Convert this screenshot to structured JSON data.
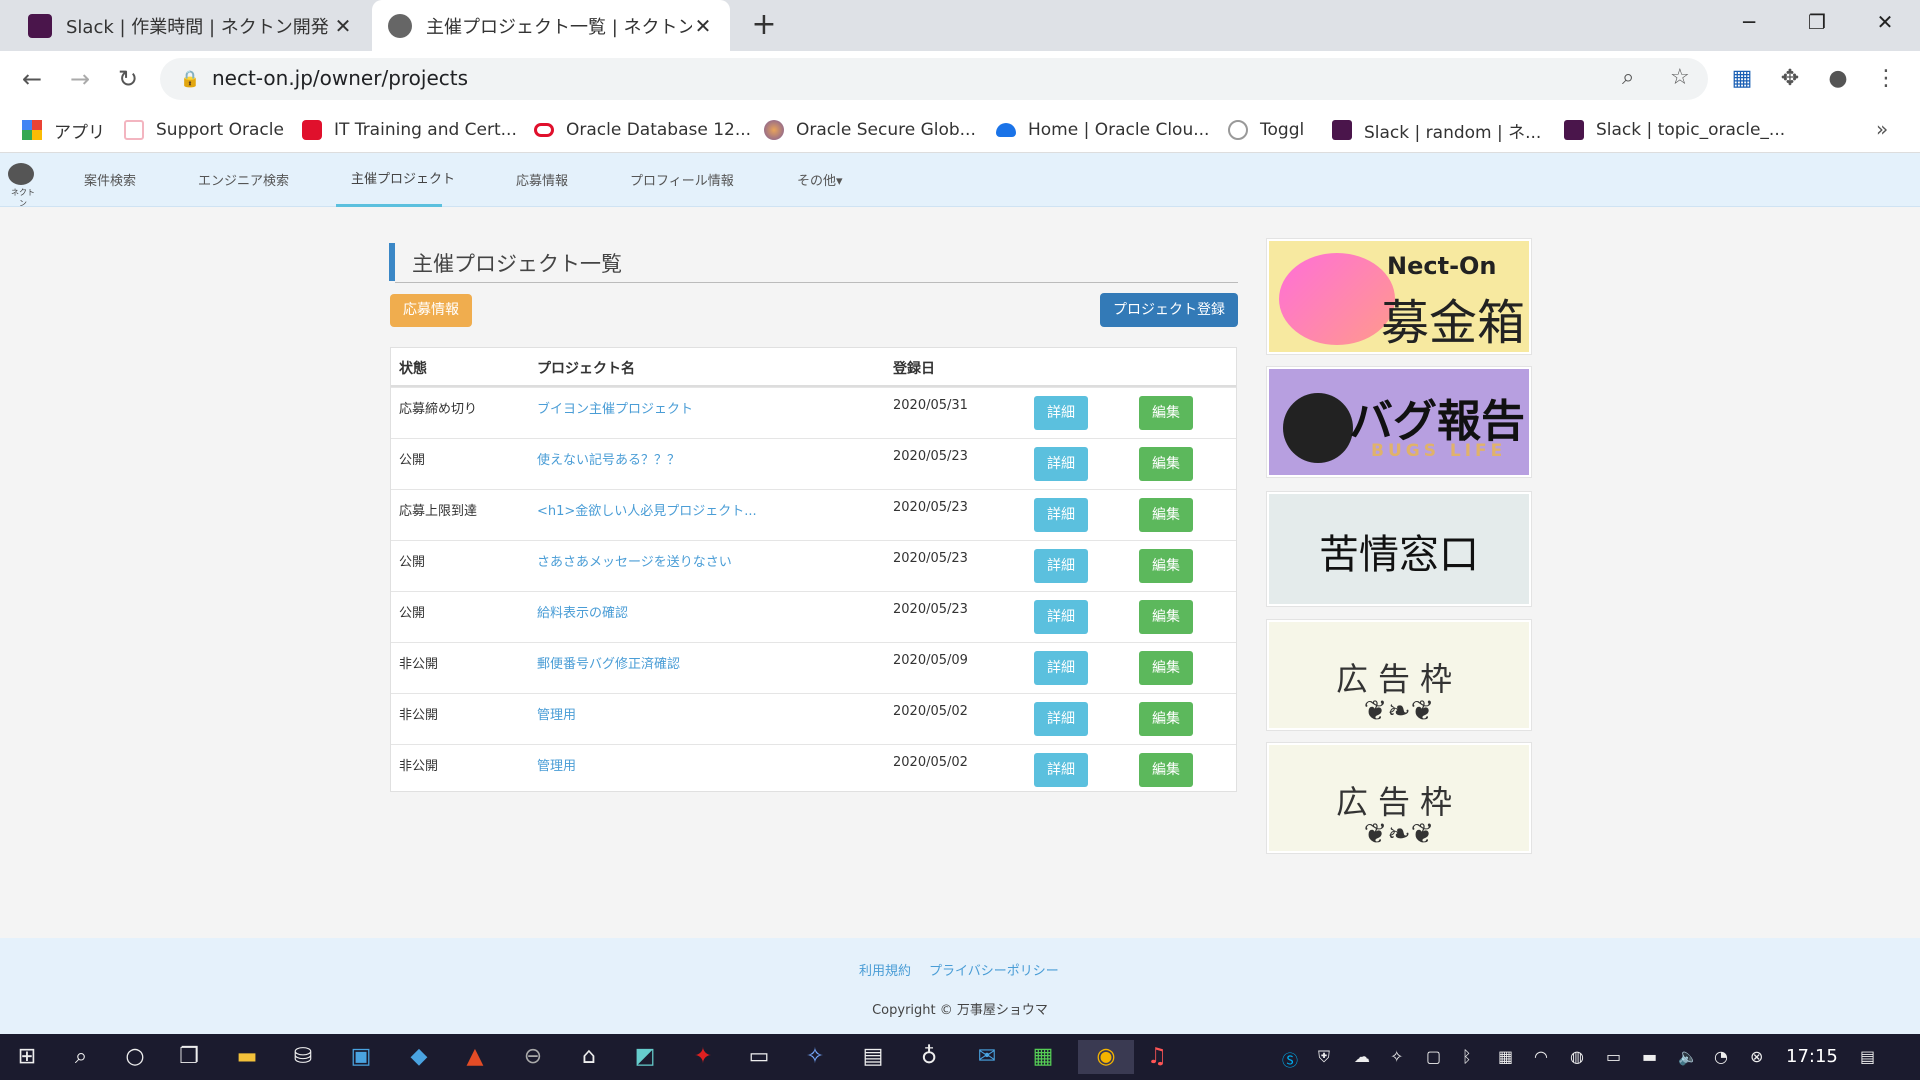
{
  "browser": {
    "tabs": [
      {
        "title": "Slack | 作業時間 | ネクトン開発",
        "close": "✕",
        "favicon": "slack-icon"
      },
      {
        "title": "主催プロジェクト一覧 | ネクトン",
        "close": "✕",
        "favicon": "nectone-icon"
      }
    ],
    "new_tab": "+",
    "window_controls": {
      "minimize": "─",
      "maximize": "❐",
      "close": "✕"
    },
    "url": "nect-on.jp/owner/projects",
    "bookmarks": [
      {
        "label": "アプリ",
        "icon": "apps-grid-icon"
      },
      {
        "label": "Support Oracle",
        "icon": "support-oracle-icon"
      },
      {
        "label": "IT Training and Cert...",
        "icon": "oracle-red-icon"
      },
      {
        "label": "Oracle Database 12...",
        "icon": "oracle-ring-icon"
      },
      {
        "label": "Oracle Secure Glob...",
        "icon": "oracle-globe-icon"
      },
      {
        "label": "Home | Oracle Clou...",
        "icon": "cloud-icon"
      },
      {
        "label": "Toggl",
        "icon": "toggl-icon"
      },
      {
        "label": "Slack | random | ネ...",
        "icon": "slack-icon"
      },
      {
        "label": "Slack | topic_oracle_...",
        "icon": "slack-icon"
      }
    ],
    "bookmarks_more": "»"
  },
  "site": {
    "logo_text": "ネクトン",
    "nav": [
      {
        "label": "案件検索"
      },
      {
        "label": "エンジニア検索"
      },
      {
        "label": "主催プロジェクト"
      },
      {
        "label": "応募情報"
      },
      {
        "label": "プロフィール情報"
      },
      {
        "label": "その他▾"
      }
    ],
    "active_nav": "主催プロジェクト",
    "page_title": "主催プロジェクト一覧",
    "apply_info_button": "応募情報",
    "register_button": "プロジェクト登録",
    "table": {
      "headers": [
        "状態",
        "プロジェクト名",
        "登録日"
      ],
      "detail_label": "詳細",
      "edit_label": "編集",
      "rows": [
        {
          "status": "応募締め切り",
          "name": "ブイヨン主催プロジェクト",
          "date": "2020/05/31"
        },
        {
          "status": "公開",
          "name": "使えない記号ある？？？",
          "date": "2020/05/23"
        },
        {
          "status": "応募上限到達",
          "name": "<h1>金欲しい人必見プロジェクト...",
          "date": "2020/05/23"
        },
        {
          "status": "公開",
          "name": "さあさあメッセージを送りなさい",
          "date": "2020/05/23"
        },
        {
          "status": "公開",
          "name": "給料表示の確認",
          "date": "2020/05/23"
        },
        {
          "status": "非公開",
          "name": "郵便番号バグ修正済確認",
          "date": "2020/05/09"
        },
        {
          "status": "非公開",
          "name": "管理用",
          "date": "2020/05/02"
        },
        {
          "status": "非公開",
          "name": "管理用",
          "date": "2020/05/02"
        }
      ]
    },
    "ads": {
      "donation": {
        "brand": "Nect-On",
        "label": "募金箱"
      },
      "bug": {
        "label": "バグ報告",
        "sub": "BUGS LIFE"
      },
      "complaint": {
        "label": "苦情窓口"
      },
      "ad_slot_1": {
        "label": "広告枠"
      },
      "ad_slot_2": {
        "label": "広告枠"
      }
    },
    "footer": {
      "terms": "利用規約",
      "privacy": "プライバシーポリシー",
      "copyright": "Copyright © 万事屋ショウマ"
    }
  },
  "taskbar": {
    "clock": "17:15"
  }
}
